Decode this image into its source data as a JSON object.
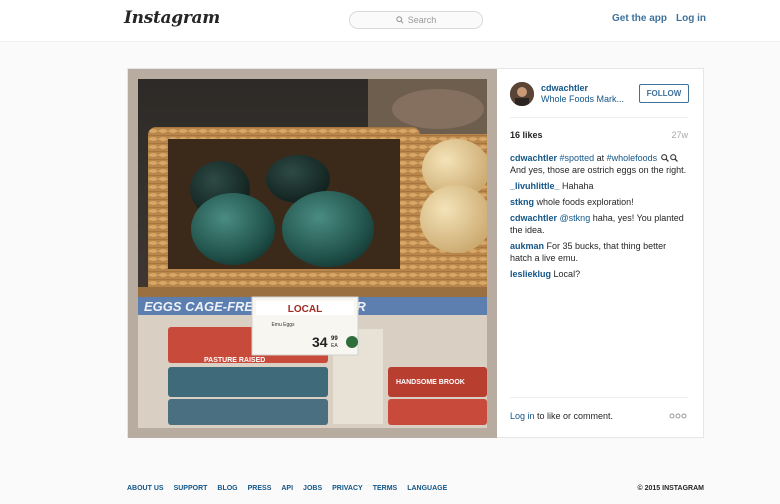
{
  "header": {
    "logo": "Instagram",
    "search_placeholder": "Search",
    "get_app": "Get the app",
    "login": "Log in"
  },
  "post": {
    "username": "cdwachtler",
    "location": "Whole Foods Mark...",
    "follow": "FOLLOW",
    "likes": "16 likes",
    "time": "27w",
    "comments": [
      {
        "user": "cdwachtler",
        "parts": [
          {
            "tag": "#spotted"
          },
          {
            "text": " at "
          },
          {
            "tag": "#wholefoods"
          }
        ],
        "tail": "And yes, those are ostrich eggs on the right."
      },
      {
        "user": "_livuhlittle_",
        "text": "Hahaha"
      },
      {
        "user": "stkng",
        "text": "whole foods exploration!"
      },
      {
        "user": "cdwachtler",
        "mention": "@stkng",
        "text": "haha, yes! You planted the idea."
      },
      {
        "user": "aukman",
        "text": "For 35 bucks, that thing better hatch a live emu."
      },
      {
        "user": "leslieklug",
        "text": "Local?"
      }
    ],
    "login_link": "Log in",
    "login_rest": " to like or comment.",
    "photo_text": {
      "local": "LOCAL",
      "product": "Emu Eggs",
      "price_main": "34",
      "price_cents": "99",
      "price_unit": "EA",
      "banner": "EGGS  CAGE-FREE EGGS  CAGE-FR",
      "pasture_left": "PASTURE RAISED",
      "pasture_right": "HANDSOME BROOK"
    }
  },
  "footer": {
    "links": [
      "ABOUT US",
      "SUPPORT",
      "BLOG",
      "PRESS",
      "API",
      "JOBS",
      "PRIVACY",
      "TERMS",
      "LANGUAGE"
    ],
    "copyright": "© 2015 INSTAGRAM"
  }
}
